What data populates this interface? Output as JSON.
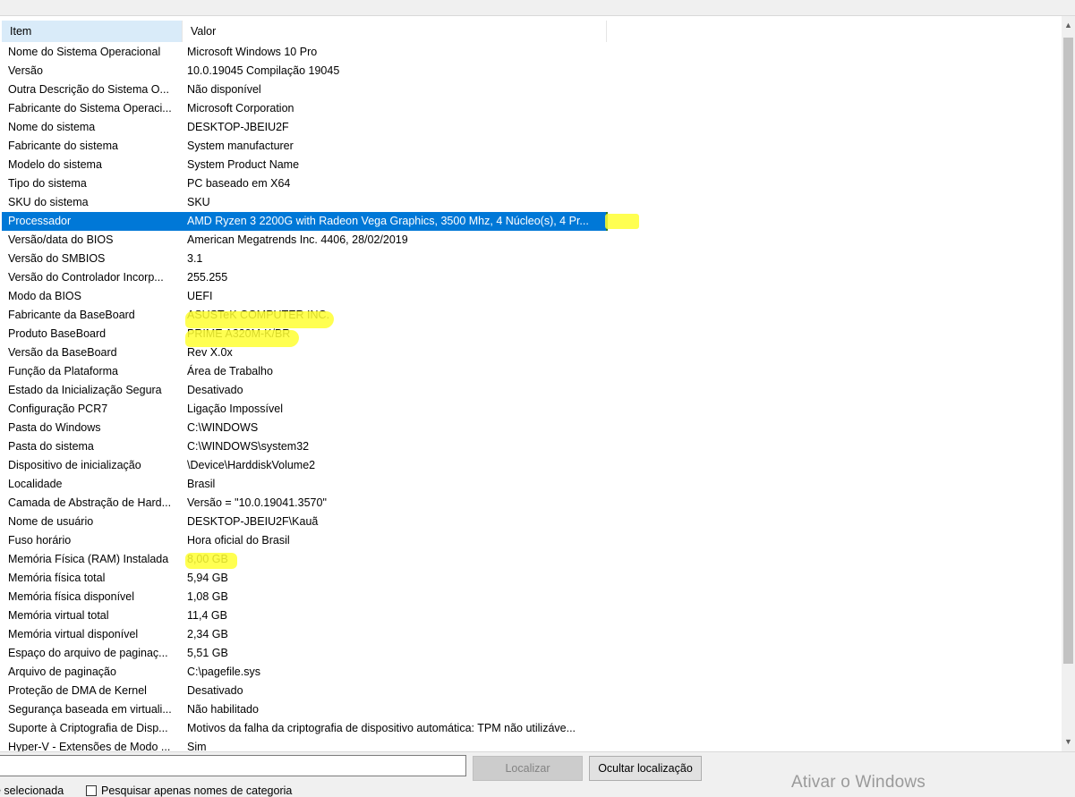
{
  "list": {
    "columns": {
      "item": "Item",
      "valor": "Valor"
    },
    "selected_index": 9,
    "rows": [
      {
        "item": "Nome do Sistema Operacional",
        "valor": "Microsoft Windows 10 Pro"
      },
      {
        "item": "Versão",
        "valor": "10.0.19045 Compilação 19045"
      },
      {
        "item": "Outra Descrição do Sistema O...",
        "valor": "Não disponível"
      },
      {
        "item": "Fabricante do Sistema Operaci...",
        "valor": "Microsoft Corporation"
      },
      {
        "item": "Nome do sistema",
        "valor": "DESKTOP-JBEIU2F"
      },
      {
        "item": "Fabricante do sistema",
        "valor": "System manufacturer"
      },
      {
        "item": "Modelo do sistema",
        "valor": "System Product Name"
      },
      {
        "item": "Tipo do sistema",
        "valor": "PC baseado em X64"
      },
      {
        "item": "SKU do sistema",
        "valor": "SKU"
      },
      {
        "item": "Processador",
        "valor": "AMD Ryzen 3 2200G with Radeon Vega Graphics, 3500 Mhz, 4 Núcleo(s), 4 Pr..."
      },
      {
        "item": "Versão/data do BIOS",
        "valor": "American Megatrends Inc. 4406, 28/02/2019"
      },
      {
        "item": "Versão do SMBIOS",
        "valor": "3.1"
      },
      {
        "item": "Versão do Controlador Incorp...",
        "valor": "255.255"
      },
      {
        "item": "Modo da BIOS",
        "valor": "UEFI"
      },
      {
        "item": "Fabricante da BaseBoard",
        "valor": "ASUSTeK COMPUTER INC."
      },
      {
        "item": "Produto BaseBoard",
        "valor": "PRIME A320M-K/BR"
      },
      {
        "item": "Versão da BaseBoard",
        "valor": "Rev X.0x"
      },
      {
        "item": "Função da Plataforma",
        "valor": "Área de Trabalho"
      },
      {
        "item": "Estado da Inicialização Segura",
        "valor": "Desativado"
      },
      {
        "item": "Configuração PCR7",
        "valor": "Ligação Impossível"
      },
      {
        "item": "Pasta do Windows",
        "valor": "C:\\WINDOWS"
      },
      {
        "item": "Pasta do sistema",
        "valor": "C:\\WINDOWS\\system32"
      },
      {
        "item": "Dispositivo de inicialização",
        "valor": "\\Device\\HarddiskVolume2"
      },
      {
        "item": "Localidade",
        "valor": "Brasil"
      },
      {
        "item": "Camada de Abstração de Hard...",
        "valor": "Versão = \"10.0.19041.3570\""
      },
      {
        "item": "Nome de usuário",
        "valor": "DESKTOP-JBEIU2F\\Kauã"
      },
      {
        "item": "Fuso horário",
        "valor": "Hora oficial do Brasil"
      },
      {
        "item": "Memória Física (RAM) Instalada",
        "valor": "8,00 GB"
      },
      {
        "item": "Memória física total",
        "valor": "5,94 GB"
      },
      {
        "item": "Memória física disponível",
        "valor": "1,08 GB"
      },
      {
        "item": "Memória virtual total",
        "valor": "11,4 GB"
      },
      {
        "item": "Memória virtual disponível",
        "valor": "2,34 GB"
      },
      {
        "item": "Espaço do arquivo de paginaç...",
        "valor": "5,51 GB"
      },
      {
        "item": "Arquivo de paginação",
        "valor": "C:\\pagefile.sys"
      },
      {
        "item": "Proteção de DMA de Kernel",
        "valor": "Desativado"
      },
      {
        "item": "Segurança baseada em virtuali...",
        "valor": "Não habilitado"
      },
      {
        "item": "Suporte à Criptografia de Disp...",
        "valor": "Motivos da falha da criptografia de dispositivo automática: TPM não utilizáve..."
      },
      {
        "item": "Hyper-V - Extensões de Modo ...",
        "valor": "Sim"
      }
    ]
  },
  "find_bar": {
    "input_value": "",
    "localizar_label": "Localizar",
    "ocultar_label": "Ocultar localização",
    "selected_label": "e selecionada",
    "category_checkbox_label": "Pesquisar apenas nomes de categoria",
    "category_checkbox_checked": false
  },
  "watermark": "Ativar o Windows",
  "colors": {
    "selection": "#0078d7",
    "highlight_marker": "#ffff33"
  }
}
